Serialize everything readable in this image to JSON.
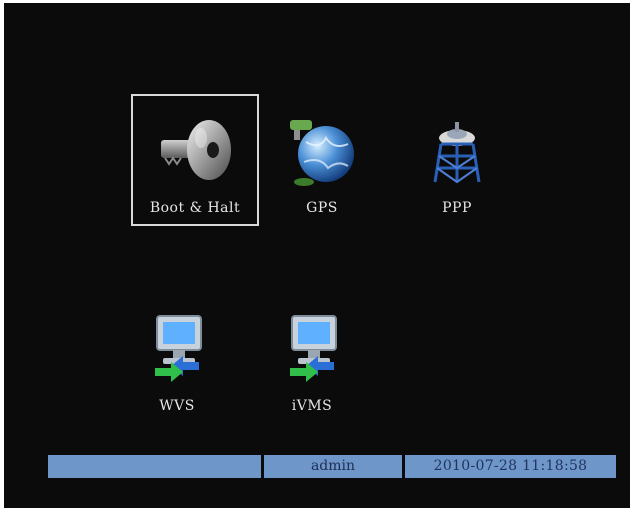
{
  "menu": {
    "items": [
      {
        "label": "Boot & Halt",
        "icon": "key-icon",
        "selected": true
      },
      {
        "label": "GPS",
        "icon": "globe-icon",
        "selected": false
      },
      {
        "label": "PPP",
        "icon": "antenna-tower-icon",
        "selected": false
      },
      {
        "label": "WVS",
        "icon": "network-computer-icon",
        "selected": false
      },
      {
        "label": "iVMS",
        "icon": "network-computer-icon",
        "selected": false
      }
    ]
  },
  "statusbar": {
    "left": "",
    "user": "admin",
    "datetime": "2010-07-28 11:18:58"
  },
  "colors": {
    "background": "#0b0b0b",
    "selection_border": "#d9d9d9",
    "statusbar_fill": "#6f96c8",
    "statusbar_text": "#1d2f55"
  }
}
